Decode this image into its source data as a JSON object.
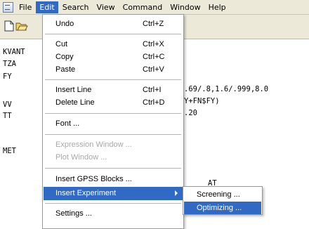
{
  "menubar": {
    "items": [
      "File",
      "Edit",
      "Search",
      "View",
      "Command",
      "Window",
      "Help"
    ],
    "active": "Edit"
  },
  "toolbar": {
    "buttons": [
      "new-document-icon",
      "open-folder-icon"
    ]
  },
  "editor": {
    "lines": [
      "KVANT",
      "TZA",
      "FY",
      "VV",
      "TT",
      "MET"
    ],
    "fragments": [
      ".69/.8,1.6/.999,8.0",
      "Y+FN$FY)",
      ".20",
      "AT"
    ]
  },
  "edit_menu": {
    "undo": {
      "label": "Undo",
      "shortcut": "Ctrl+Z"
    },
    "cut": {
      "label": "Cut",
      "shortcut": "Ctrl+X"
    },
    "copy": {
      "label": "Copy",
      "shortcut": "Ctrl+C"
    },
    "paste": {
      "label": "Paste",
      "shortcut": "Ctrl+V"
    },
    "insert_line": {
      "label": "Insert Line",
      "shortcut": "Ctrl+I"
    },
    "delete_line": {
      "label": "Delete Line",
      "shortcut": "Ctrl+D"
    },
    "font": {
      "label": "Font ..."
    },
    "expression_window": {
      "label": "Expression Window ..."
    },
    "plot_window": {
      "label": "Plot Window ..."
    },
    "insert_gpss_blocks": {
      "label": "Insert GPSS Blocks ..."
    },
    "insert_experiment": {
      "label": "Insert Experiment"
    },
    "settings": {
      "label": "Settings ..."
    }
  },
  "experiment_submenu": {
    "screening": "Screening ...",
    "optimizing": "Optimizing ..."
  },
  "colors": {
    "highlight": "#316ac5",
    "menubar_bg": "#ece9d8",
    "disabled_text": "#a8a8a8"
  }
}
